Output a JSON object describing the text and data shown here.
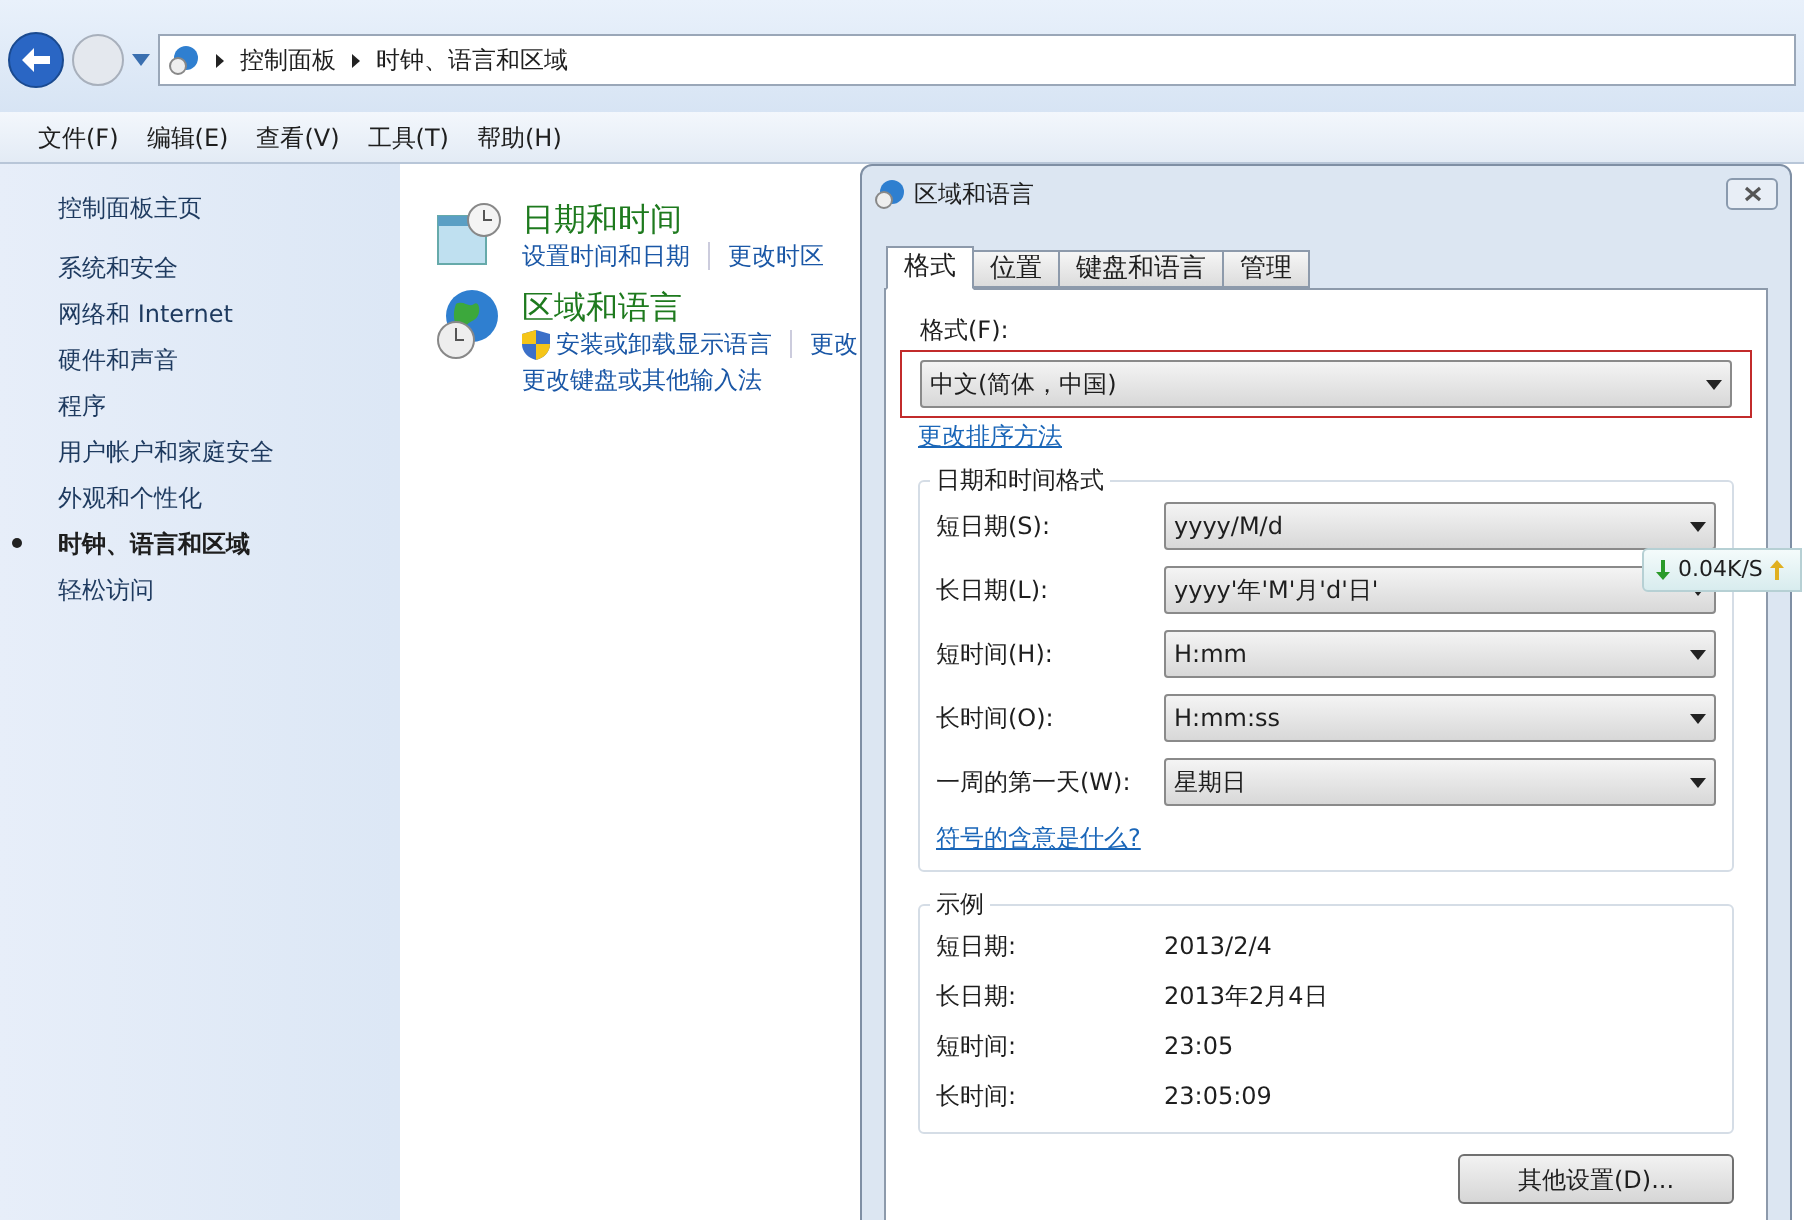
{
  "nav": {
    "breadcrumb": [
      "控制面板",
      "时钟、语言和区域"
    ]
  },
  "menu": [
    "文件(F)",
    "编辑(E)",
    "查看(V)",
    "工具(T)",
    "帮助(H)"
  ],
  "sidebar": {
    "home": "控制面板主页",
    "items": [
      {
        "label": "系统和安全",
        "selected": false
      },
      {
        "label": "网络和 Internet",
        "selected": false
      },
      {
        "label": "硬件和声音",
        "selected": false
      },
      {
        "label": "程序",
        "selected": false
      },
      {
        "label": "用户帐户和家庭安全",
        "selected": false
      },
      {
        "label": "外观和个性化",
        "selected": false
      },
      {
        "label": "时钟、语言和区域",
        "selected": true
      },
      {
        "label": "轻松访问",
        "selected": false
      }
    ]
  },
  "categories": [
    {
      "kind": "date",
      "title": "日期和时间",
      "links": [
        {
          "label": "设置时间和日期",
          "shield": false
        },
        {
          "label": "更改时区",
          "shield": false
        }
      ]
    },
    {
      "kind": "region",
      "title": "区域和语言",
      "links": [
        {
          "label": "安装或卸载显示语言",
          "shield": true
        },
        {
          "label": "更改",
          "shield": false
        },
        {
          "label": "更改键盘或其他输入法",
          "shield": false
        }
      ]
    }
  ],
  "dialog": {
    "title": "区域和语言",
    "tabs": [
      {
        "label": "格式",
        "selected": true
      },
      {
        "label": "位置",
        "selected": false
      },
      {
        "label": "键盘和语言",
        "selected": false
      },
      {
        "label": "管理",
        "selected": false
      }
    ],
    "format_label": "格式(F):",
    "format_value": "中文(简体，中国)",
    "sort_link": "更改排序方法",
    "group_title": "日期和时间格式",
    "fields": [
      {
        "label": "短日期(S):",
        "value": "yyyy/M/d"
      },
      {
        "label": "长日期(L):",
        "value": "yyyy'年'M'月'd'日'"
      },
      {
        "label": "短时间(H):",
        "value": "H:mm"
      },
      {
        "label": "长时间(O):",
        "value": "H:mm:ss"
      },
      {
        "label": "一周的第一天(W):",
        "value": "星期日"
      }
    ],
    "symbols_link": "符号的含意是什么?",
    "example_title": "示例",
    "examples": [
      {
        "label": "短日期:",
        "value": "2013/2/4"
      },
      {
        "label": "长日期:",
        "value": "2013年2月4日"
      },
      {
        "label": "短时间:",
        "value": "23:05"
      },
      {
        "label": "长时间:",
        "value": "23:05:09"
      }
    ],
    "button": "其他设置(D)..."
  },
  "net_speed": {
    "download": "0.04K/S"
  }
}
